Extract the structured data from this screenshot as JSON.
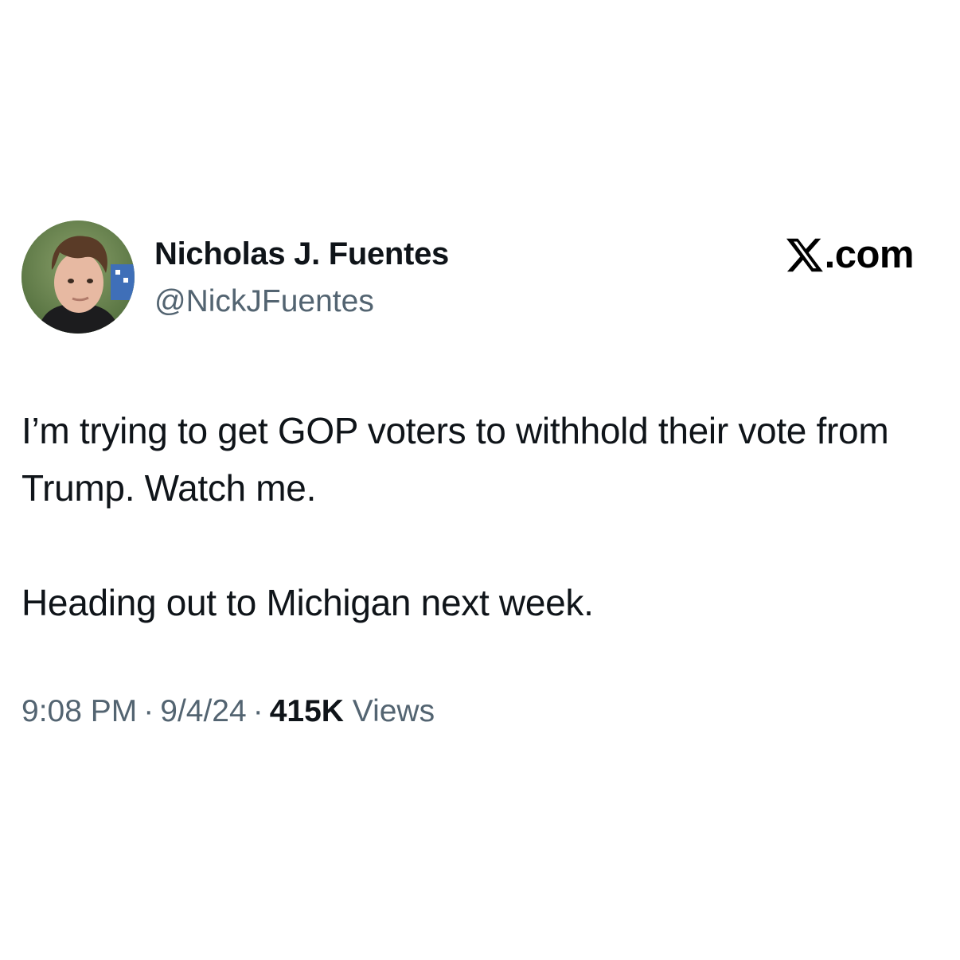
{
  "author": {
    "display_name": "Nicholas J. Fuentes",
    "handle": "@NickJFuentes",
    "avatar": "profile-photo"
  },
  "brand": {
    "icon": "x-logo-icon",
    "suffix": ".com"
  },
  "tweet": {
    "paragraphs": [
      "I’m trying to get GOP voters to withhold their vote from Trump. Watch me.",
      "Heading out to Michigan next week."
    ]
  },
  "meta": {
    "time": "9:08 PM",
    "separator": "·",
    "date": "9/4/24",
    "views_count": "415K",
    "views_label": "Views"
  },
  "colors": {
    "text_primary": "#0f1419",
    "text_secondary": "#536471",
    "background": "#ffffff"
  }
}
